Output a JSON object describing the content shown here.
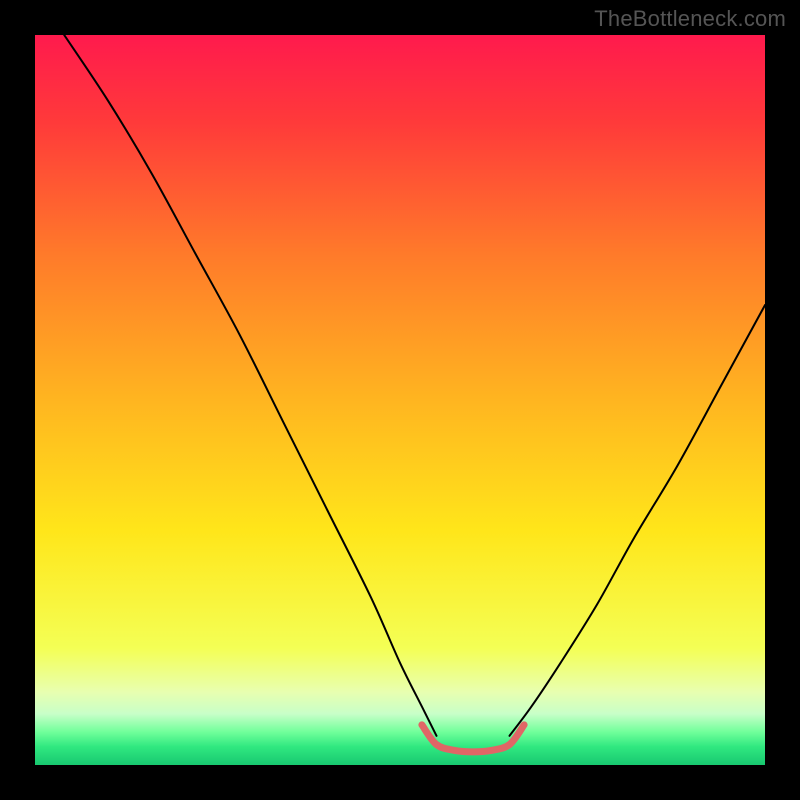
{
  "watermark": "TheBottleneck.com",
  "chart_data": {
    "type": "line",
    "title": "",
    "xlabel": "",
    "ylabel": "",
    "xlim": [
      0,
      100
    ],
    "ylim": [
      0,
      100
    ],
    "grid": false,
    "legend": false,
    "annotations": [
      {
        "text": "TheBottleneck.com",
        "position": "top-right"
      }
    ],
    "background_gradient": {
      "orientation": "vertical",
      "stops": [
        {
          "t": 0.0,
          "color": "#ff1a4d"
        },
        {
          "t": 0.12,
          "color": "#ff3a3a"
        },
        {
          "t": 0.3,
          "color": "#ff7a2a"
        },
        {
          "t": 0.5,
          "color": "#ffb520"
        },
        {
          "t": 0.68,
          "color": "#ffe61a"
        },
        {
          "t": 0.84,
          "color": "#f4ff55"
        },
        {
          "t": 0.9,
          "color": "#e8ffb0"
        },
        {
          "t": 0.93,
          "color": "#c8ffc8"
        },
        {
          "t": 0.955,
          "color": "#70ff9a"
        },
        {
          "t": 0.975,
          "color": "#30e880"
        },
        {
          "t": 1.0,
          "color": "#18c870"
        }
      ]
    },
    "series": [
      {
        "name": "left-branch",
        "stroke": "#000000",
        "stroke_width": 2,
        "x": [
          4,
          10,
          16,
          22,
          28,
          34,
          40,
          46,
          50,
          53,
          55
        ],
        "y": [
          100,
          91,
          81,
          70,
          59,
          47,
          35,
          23,
          14,
          8,
          4
        ]
      },
      {
        "name": "right-branch",
        "stroke": "#000000",
        "stroke_width": 2,
        "x": [
          65,
          68,
          72,
          77,
          82,
          88,
          94,
          100
        ],
        "y": [
          4,
          8,
          14,
          22,
          31,
          41,
          52,
          63
        ]
      },
      {
        "name": "valley-highlight",
        "stroke": "#e06666",
        "stroke_width": 7,
        "x": [
          53,
          55,
          57.5,
          60,
          62.5,
          65,
          67
        ],
        "y": [
          5.5,
          2.8,
          2.0,
          1.8,
          2.0,
          2.8,
          5.5
        ]
      }
    ]
  }
}
